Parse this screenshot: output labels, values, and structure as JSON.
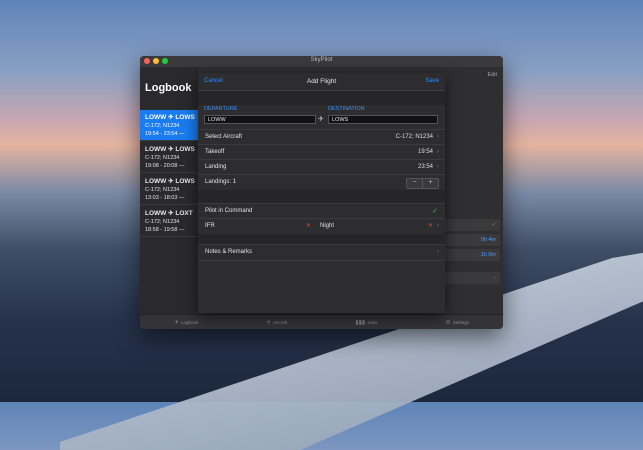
{
  "window": {
    "title": "SkyPilot"
  },
  "colors": {
    "accent": "#1a7cf0",
    "link": "#2d8cff",
    "check": "#34c759",
    "cross": "#ff3b30"
  },
  "logbook": {
    "title": "Logbook",
    "edit_label": "Edit",
    "flights": [
      {
        "from": "LOWW",
        "to": "LOWS",
        "aircraft": "C-172; N1234",
        "times": "19:54 - 23:54 —",
        "selected": true
      },
      {
        "from": "LOWW",
        "to": "LOWS",
        "aircraft": "C-172; N1234",
        "times": "19:08 - 20:08 —",
        "selected": false
      },
      {
        "from": "LOWW",
        "to": "LOWS",
        "aircraft": "C-172; N1234",
        "times": "13:03 - 18:03 —",
        "selected": false
      },
      {
        "from": "LOWW",
        "to": "LOXT",
        "aircraft": "C-172; N1234",
        "times": "18:58 - 19:58 —",
        "selected": false
      }
    ],
    "bg_values": [
      "0h 4m",
      "1h 0m"
    ]
  },
  "tabs": [
    {
      "label": "Logbook",
      "icon": "logbook-icon"
    },
    {
      "label": "Aircraft",
      "icon": "airplane-icon"
    },
    {
      "label": "Stats",
      "icon": "stats-icon"
    },
    {
      "label": "Settings",
      "icon": "gear-icon"
    }
  ],
  "add_flight": {
    "cancel": "Cancel",
    "title": "Add Flight",
    "save": "Save",
    "departure_label": "DEPARTURE",
    "destination_label": "DESTINATION",
    "departure_value": "LOWW",
    "destination_value": "LOWS",
    "select_aircraft_label": "Select Aircraft",
    "select_aircraft_value": "C-172; N1234",
    "takeoff_label": "Takeoff",
    "takeoff_value": "19:54",
    "landing_label": "Landing",
    "landing_value": "23:54",
    "landings_label": "Landings: 1",
    "stepper_minus": "−",
    "stepper_plus": "+",
    "pic_label": "Pilot in Command",
    "ifr_label": "IFR",
    "night_label": "Night",
    "notes_label": "Notes & Remarks"
  }
}
